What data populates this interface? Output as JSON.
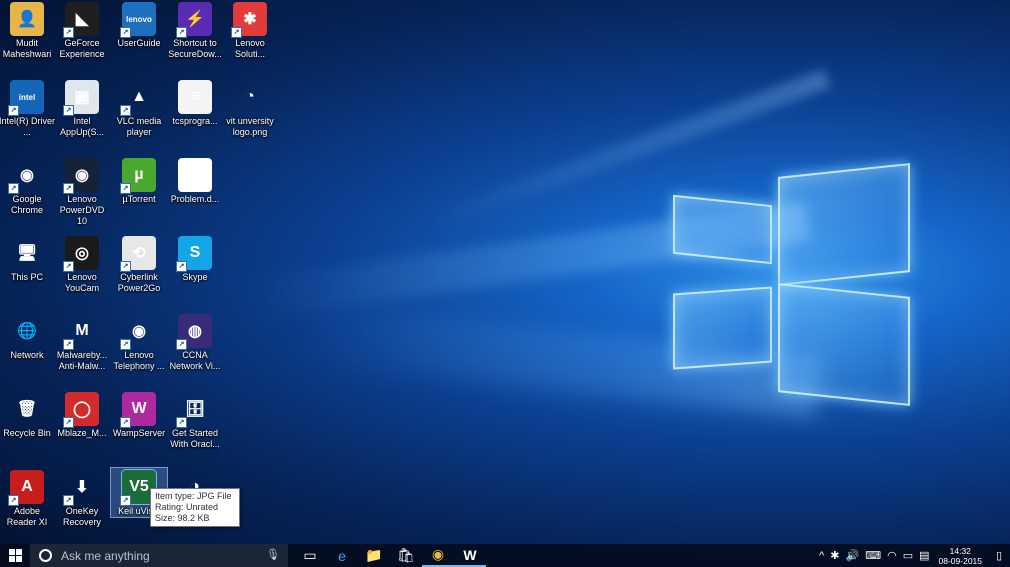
{
  "desktop": {
    "icons": [
      {
        "label": "Mudit Maheshwari",
        "icon": "user-folder-icon",
        "color": "#e7b54a",
        "glyph": "👤"
      },
      {
        "label": "GeForce Experience",
        "icon": "nvidia-icon",
        "color": "#1f1f1f",
        "glyph": "◣"
      },
      {
        "label": "UserGuide",
        "icon": "lenovo-guide-icon",
        "color": "#1d6fbf",
        "glyph": "lenovo"
      },
      {
        "label": "Shortcut to SecureDow...",
        "icon": "securedownload-icon",
        "color": "#5b2bb5",
        "glyph": "⚡"
      },
      {
        "label": "Lenovo Soluti...",
        "icon": "lenovo-solutions-icon",
        "color": "#e23b3b",
        "glyph": "✱"
      },
      {
        "label": "Intel(R) Driver ...",
        "icon": "intel-driver-icon",
        "color": "#1466b8",
        "glyph": "intel"
      },
      {
        "label": "Intel AppUp(S...",
        "icon": "intel-appup-icon",
        "color": "#dfe6ee",
        "glyph": "▣"
      },
      {
        "label": "VLC media player",
        "icon": "vlc-icon",
        "color": "transparent",
        "glyph": "▲"
      },
      {
        "label": "tcsprogra...",
        "icon": "text-file-icon",
        "color": "#f4f4f4",
        "glyph": "≡"
      },
      {
        "label": "vit unversity logo.png",
        "icon": "image-file-icon",
        "color": "transparent",
        "glyph": "◔"
      },
      {
        "label": "Google Chrome",
        "icon": "chrome-icon",
        "color": "transparent",
        "glyph": "◉"
      },
      {
        "label": "Lenovo PowerDVD 10",
        "icon": "powerdvd-icon",
        "color": "#162238",
        "glyph": "◉"
      },
      {
        "label": "µTorrent",
        "icon": "utorrent-icon",
        "color": "#4aa82e",
        "glyph": "µ"
      },
      {
        "label": "Problem.d...",
        "icon": "word-doc-icon",
        "color": "#ffffff",
        "glyph": "W"
      },
      {
        "label": "This PC",
        "icon": "this-pc-icon",
        "color": "transparent",
        "glyph": "🖥"
      },
      {
        "label": "Lenovo YouCam",
        "icon": "youcam-icon",
        "color": "#1a1a1a",
        "glyph": "◎"
      },
      {
        "label": "Cyberlink Power2Go",
        "icon": "power2go-icon",
        "color": "#e7e7e7",
        "glyph": "⟲"
      },
      {
        "label": "Skype",
        "icon": "skype-icon",
        "color": "#12a6e8",
        "glyph": "S"
      },
      {
        "label": "Network",
        "icon": "network-icon",
        "color": "transparent",
        "glyph": "🌐"
      },
      {
        "label": "Malwareby... Anti-Malw...",
        "icon": "malwarebytes-icon",
        "color": "transparent",
        "glyph": "M"
      },
      {
        "label": "Lenovo Telephony ...",
        "icon": "chrome-telephony-icon",
        "color": "transparent",
        "glyph": "◉"
      },
      {
        "label": "CCNA Network Vi...",
        "icon": "ccna-icon",
        "color": "#3a2b7a",
        "glyph": "◍"
      },
      {
        "label": "Recycle Bin",
        "icon": "recycle-bin-icon",
        "color": "transparent",
        "glyph": "🗑"
      },
      {
        "label": "Mblaze_M...",
        "icon": "mblaze-icon",
        "color": "#d42a2a",
        "glyph": "◯"
      },
      {
        "label": "WampServer",
        "icon": "wampserver-icon",
        "color": "#b0289f",
        "glyph": "W"
      },
      {
        "label": "Get Started With Oracl...",
        "icon": "oracle-icon",
        "color": "transparent",
        "glyph": "🗄"
      },
      {
        "label": "Adobe Reader XI",
        "icon": "adobe-reader-icon",
        "color": "#c81d1d",
        "glyph": "A"
      },
      {
        "label": "OneKey Recovery",
        "icon": "onekey-recovery-icon",
        "color": "transparent",
        "glyph": "⬇"
      },
      {
        "label": "Keil uVisio",
        "icon": "keil-icon",
        "color": "#1c6b3a",
        "glyph": "V5"
      },
      {
        "label": "Recordi...",
        "icon": "recording-icon",
        "color": "transparent",
        "glyph": "◑"
      }
    ]
  },
  "tooltip": {
    "type": "Item type: JPG File",
    "rating": "Rating: Unrated",
    "size": "Size: 98.2 KB"
  },
  "taskbar": {
    "search_placeholder": "Ask me anything",
    "pinned": [
      {
        "name": "task-view-icon",
        "glyph": "▭"
      },
      {
        "name": "edge-icon",
        "glyph": "e"
      },
      {
        "name": "file-explorer-icon",
        "glyph": "📁"
      },
      {
        "name": "store-icon",
        "glyph": "🛍"
      },
      {
        "name": "chrome-icon",
        "glyph": "◉"
      },
      {
        "name": "word-icon",
        "glyph": "W"
      }
    ],
    "clock": {
      "time": "14:32",
      "date": "08-09-2015"
    }
  }
}
